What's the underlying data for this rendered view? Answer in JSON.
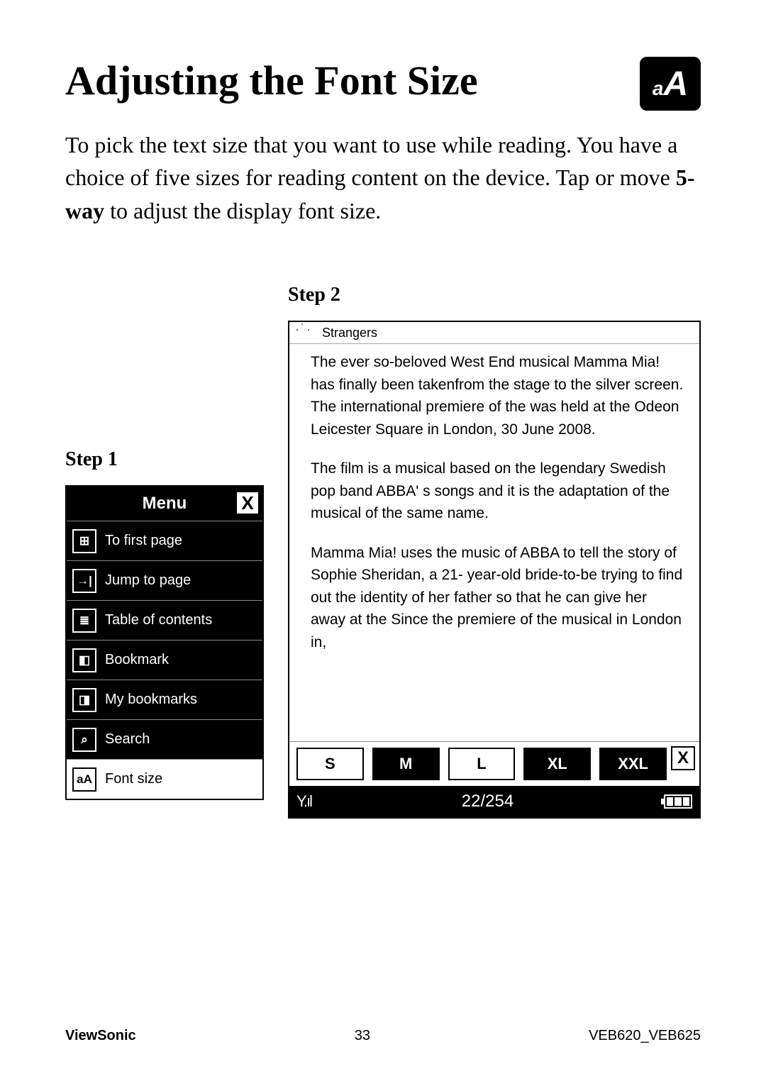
{
  "heading": "Adjusting the Font Size",
  "intro_before_bold": "To pick the text size that you want to use while reading. You have a choice of five sizes for reading content on the device. Tap or move ",
  "intro_bold": "5-way",
  "intro_after_bold": " to adjust the display font size.",
  "step1_label": "Step 1",
  "step2_label": "Step 2",
  "menu": {
    "title": "Menu",
    "items": [
      {
        "icon": "⊞",
        "label": "To first page"
      },
      {
        "icon": "→|",
        "label": "Jump to page"
      },
      {
        "icon": "≣",
        "label": "Table of contents"
      },
      {
        "icon": "◧",
        "label": "Bookmark"
      },
      {
        "icon": "◨",
        "label": "My bookmarks"
      },
      {
        "icon": "⌕",
        "label": "Search"
      },
      {
        "icon": "aA",
        "label": "Font size"
      }
    ]
  },
  "reader": {
    "doc_title": "Strangers",
    "p1": "The ever so-beloved West End musical Mamma Mia! has finally been takenfrom the stage to the silver screen. The international premiere of the was held at the Odeon Leicester Square in London, 30 June 2008.",
    "p2": "The film is a musical based on the legendary Swedish pop band ABBA' s songs and it is the adaptation of the musical of the same name.",
    "p3": "Mamma Mia! uses the music of ABBA to tell the story of Sophie Sheridan, a 21- year-old bride-to-be trying to find out the identity of her father so that he can give her away at the Since the premiere of the musical in London in,",
    "sizes": {
      "s": "S",
      "m": "M",
      "l": "L",
      "xl": "XL",
      "xxl": "XXL"
    },
    "page_indicator": "22/254"
  },
  "footer": {
    "brand": "ViewSonic",
    "page_no": "33",
    "doc_id": "VEB620_VEB625"
  }
}
